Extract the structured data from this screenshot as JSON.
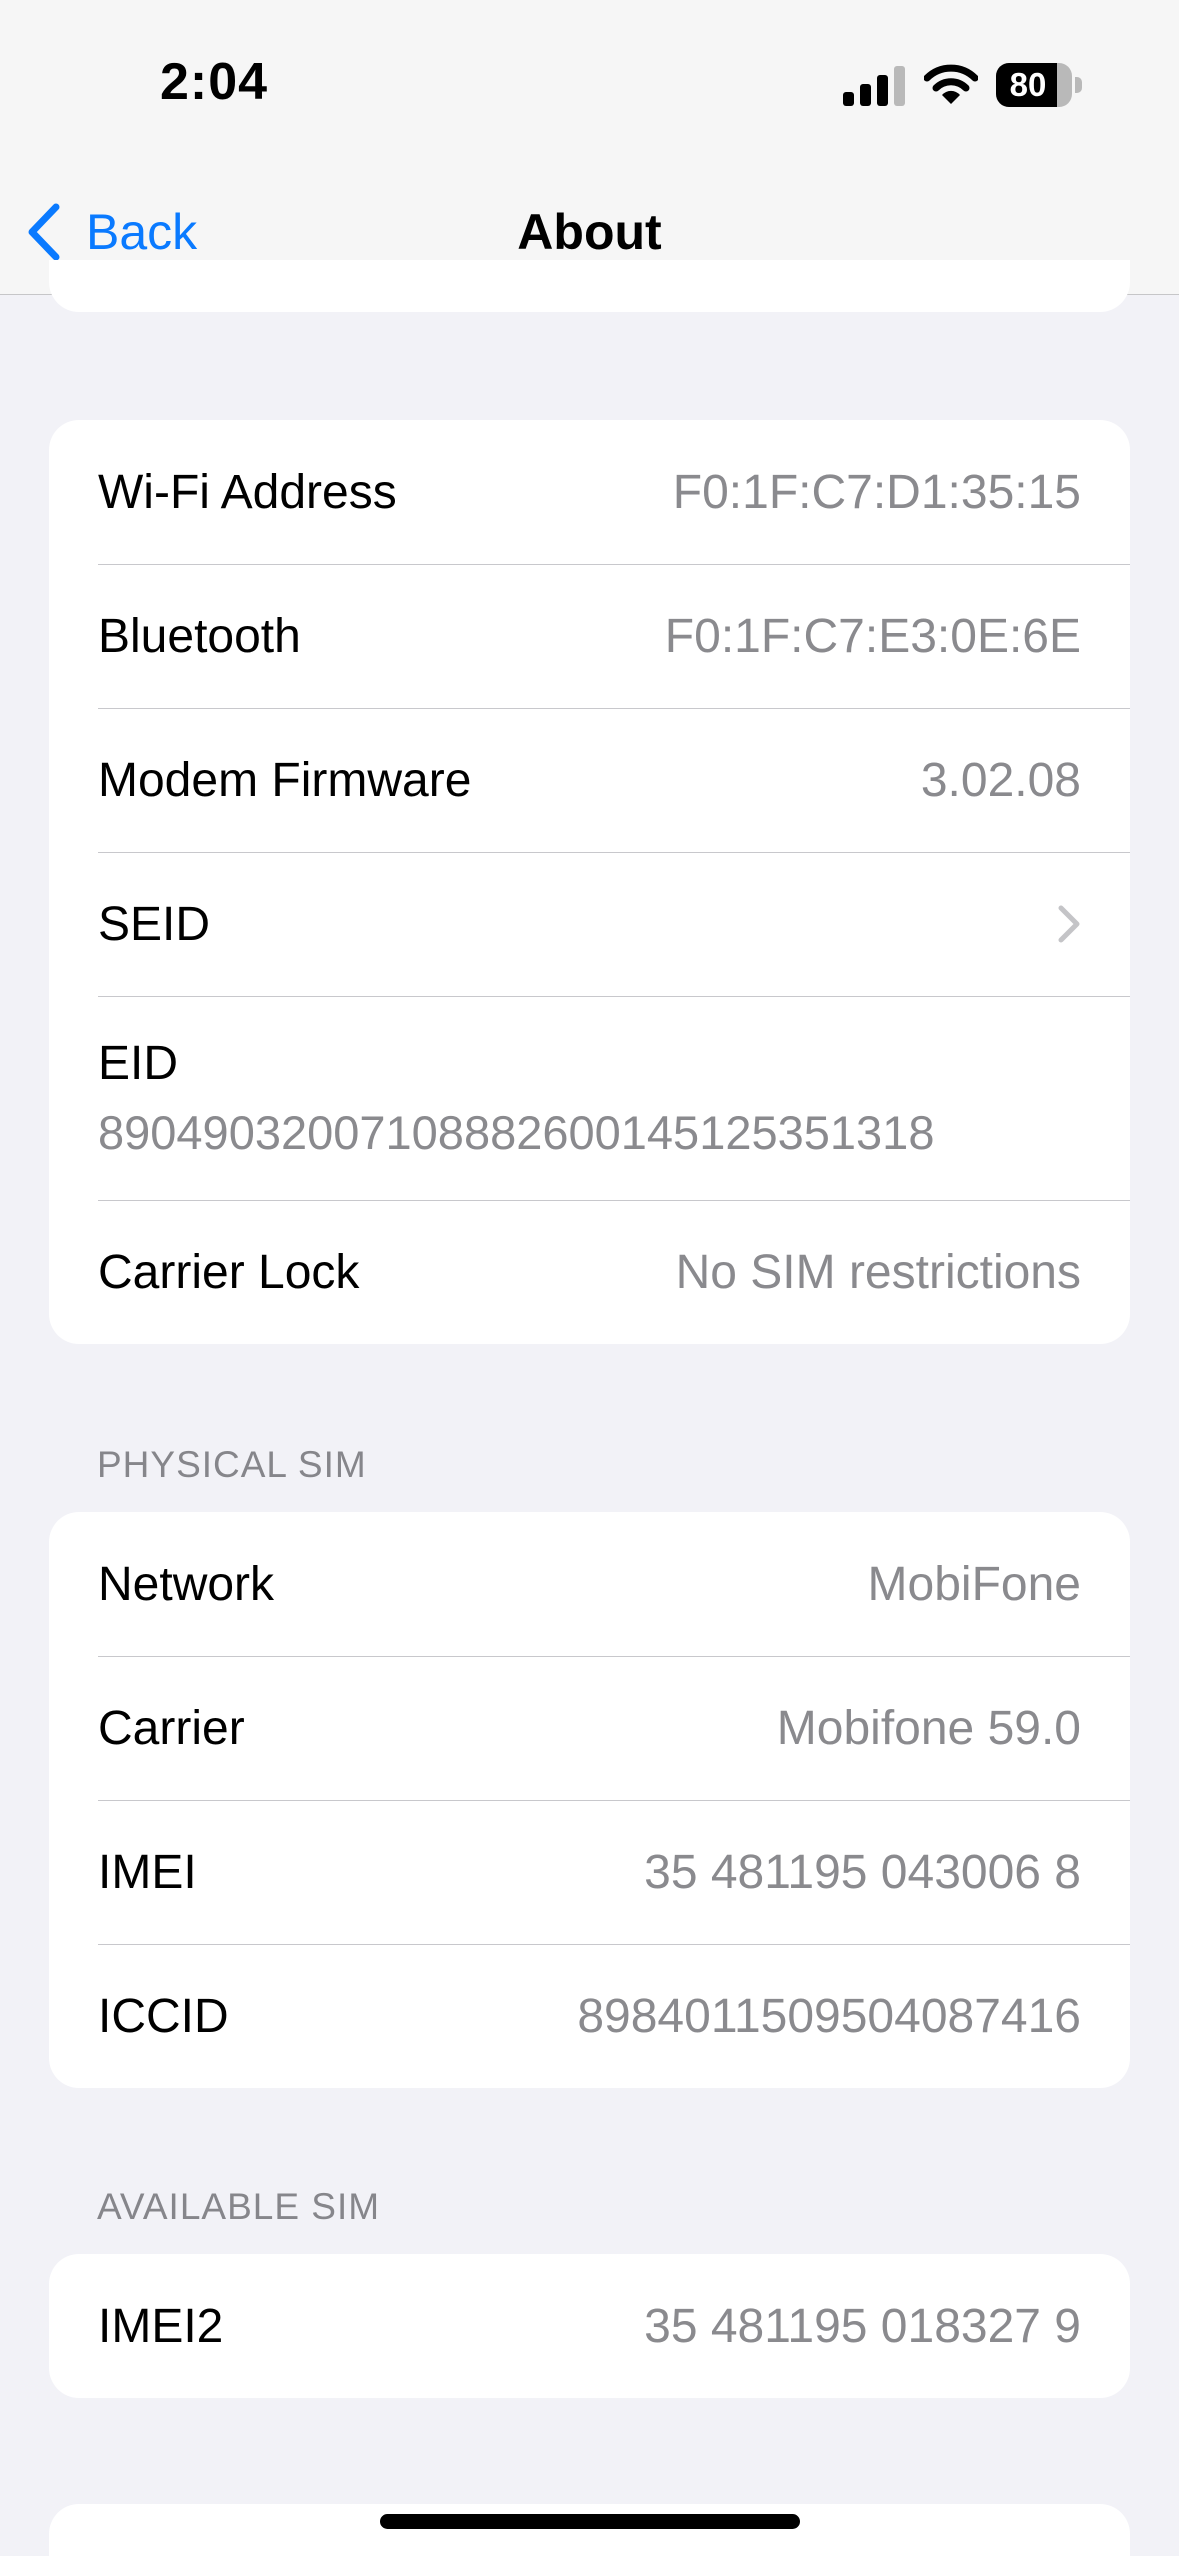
{
  "status_bar": {
    "time": "2:04",
    "battery_level": "80",
    "signal_icon": "cellular-signal-icon",
    "wifi_icon": "wifi-icon"
  },
  "nav": {
    "back_label": "Back",
    "title": "About"
  },
  "device_info": [
    {
      "label": "Wi-Fi Address",
      "value": "F0:1F:C7:D1:35:15"
    },
    {
      "label": "Bluetooth",
      "value": "F0:1F:C7:E3:0E:6E"
    },
    {
      "label": "Modem Firmware",
      "value": "3.02.08"
    },
    {
      "label": "SEID",
      "value": ""
    },
    {
      "label": "EID",
      "value": "89049032007108882600145125351318"
    },
    {
      "label": "Carrier Lock",
      "value": "No SIM restrictions"
    }
  ],
  "physical_sim": {
    "header": "PHYSICAL SIM",
    "rows": [
      {
        "label": "Network",
        "value": "MobiFone"
      },
      {
        "label": "Carrier",
        "value": "Mobifone 59.0"
      },
      {
        "label": "IMEI",
        "value": "35 481195 043006 8"
      },
      {
        "label": "ICCID",
        "value": "8984011509504087416"
      }
    ]
  },
  "available_sim": {
    "header": "AVAILABLE SIM",
    "rows": [
      {
        "label": "IMEI2",
        "value": "35 481195 018327 9"
      }
    ]
  },
  "colors": {
    "accent": "#0a7aff",
    "background": "#f2f2f7",
    "secondary_text": "#8a8a8e"
  }
}
